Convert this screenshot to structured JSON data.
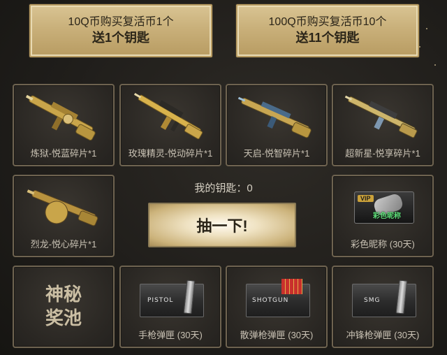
{
  "top_buttons": [
    {
      "line1": "10Q币购买复活币1个",
      "line2": "送1个钥匙"
    },
    {
      "line1": "100Q币购买复活币10个",
      "line2": "送11个钥匙"
    }
  ],
  "prizes": [
    {
      "name": "炼狱-悦蓝碎片*1"
    },
    {
      "name": "玫瑰精灵-悦动碎片*1"
    },
    {
      "name": "天启-悦智碎片*1"
    },
    {
      "name": "超新星-悦享碎片*1"
    },
    {
      "name": "烈龙-悦心碎片*1"
    },
    {
      "name": "彩色昵称 (30天)",
      "badge_vip": "VIP",
      "badge_text": "彩色昵称"
    },
    {
      "name": "手枪弹匣 (30天)",
      "tag": "PISTOL"
    },
    {
      "name": "散弹枪弹匣 (30天)",
      "tag": "SHOTGUN"
    },
    {
      "name": "冲锋枪弹匣 (30天)",
      "tag": "SMG"
    }
  ],
  "keys_text": "我的钥匙：0",
  "draw_button": "抽一下!",
  "pool_line1": "神秘",
  "pool_line2": "奖池",
  "colors": {
    "gold": "#c9b07a",
    "border": "#6e6350",
    "bg": "#1f1d1a"
  }
}
